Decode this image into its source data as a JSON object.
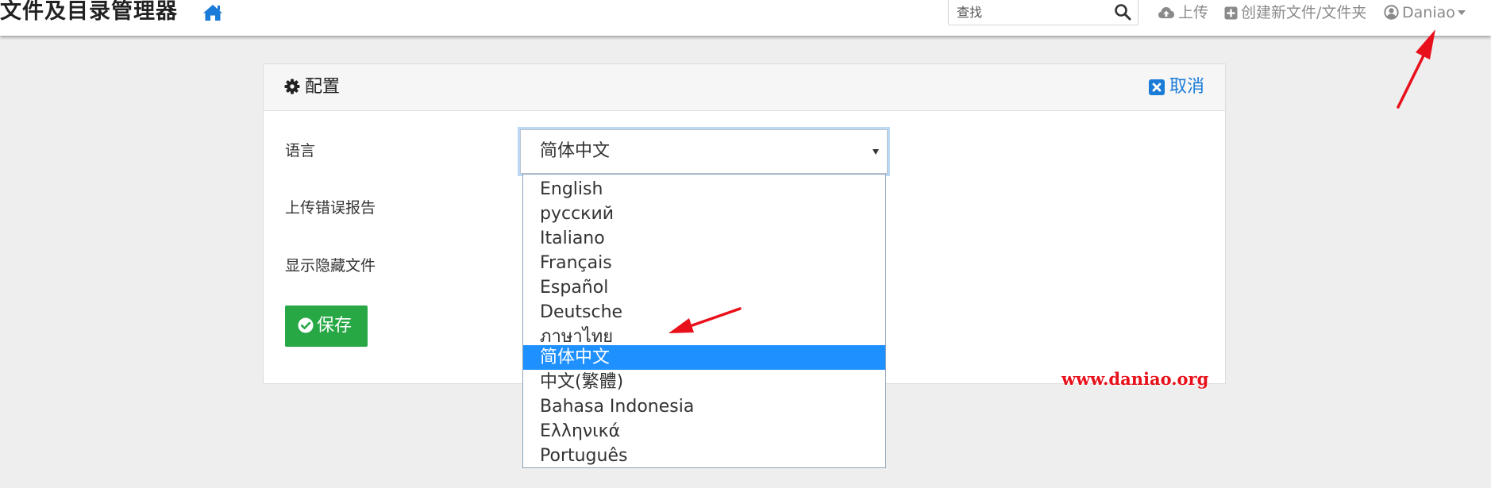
{
  "navbar": {
    "brand": "文件及目录管理器",
    "home_icon": "home-icon",
    "search_placeholder": "查找",
    "upload_label": "上传",
    "create_label": "创建新文件/文件夹",
    "user_label": "Daniao"
  },
  "config_card": {
    "title": "配置",
    "cancel_label": "取消",
    "language_label": "语言",
    "error_report_label": "上传错误报告",
    "hidden_files_label": "显示隐藏文件",
    "save_label": "保存"
  },
  "language_select": {
    "selected": "简体中文",
    "options": [
      "English",
      "русский",
      "Italiano",
      "Français",
      "Español",
      "Deutsche",
      "ภาษาไทย",
      "简体中文",
      "中文(繁體)",
      "Bahasa Indonesia",
      "Ελληνικά",
      "Português"
    ]
  },
  "watermark": "www.daniao.org",
  "colors": {
    "accent": "#1a7bd8",
    "save_button": "#28a745",
    "selected_option": "#1e90ff",
    "annotation": "#e8101a"
  }
}
